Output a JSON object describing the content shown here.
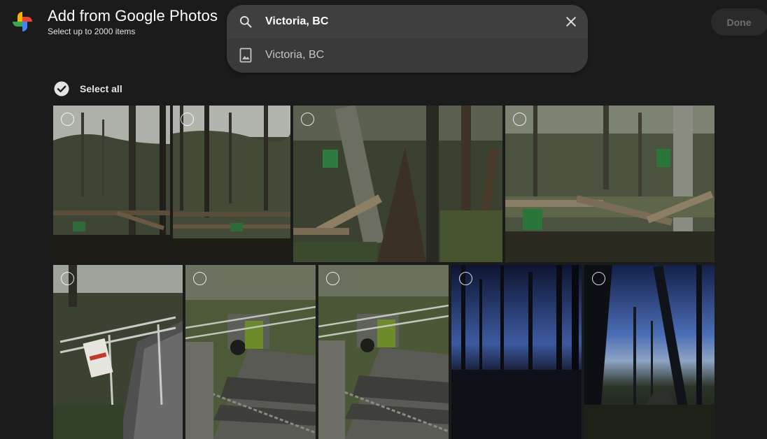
{
  "header": {
    "title": "Add from Google Photos",
    "subtitle": "Select up to 2000 items",
    "done_label": "Done"
  },
  "search": {
    "value": "Victoria, BC",
    "suggestion": "Victoria, BC"
  },
  "select_all": {
    "label": "Select all"
  },
  "icons": {
    "logo": "google-photos-pinwheel-icon",
    "search": "search-icon",
    "clear": "close-icon",
    "suggestion": "photo-album-icon",
    "select_all": "check-circle-icon",
    "photo_select": "empty-circle-icon"
  },
  "colors": {
    "background": "#1c1b1b",
    "search_bg": "#3f3f3f",
    "done_bg": "#2a2a2a",
    "done_text": "#6f6f6f"
  }
}
